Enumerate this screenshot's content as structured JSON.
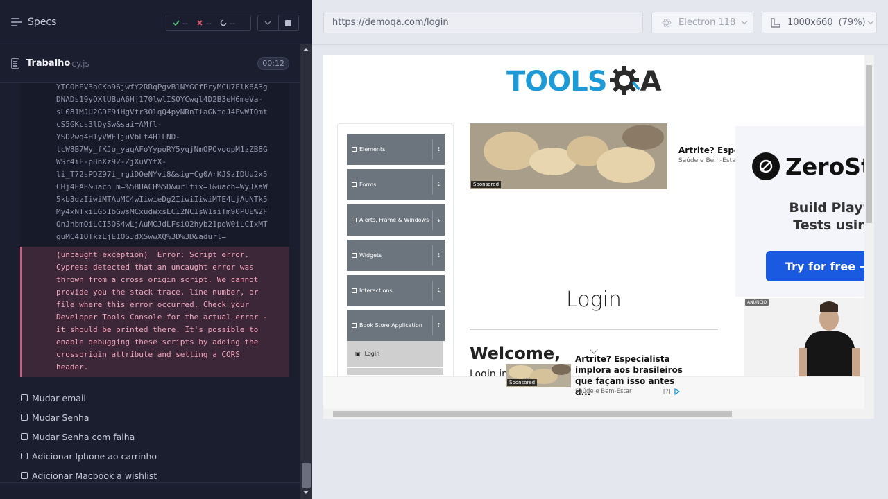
{
  "reporter": {
    "title": "Specs",
    "stats": {
      "passed": "--",
      "failed": "--",
      "pending": "--"
    },
    "spec_name": "Trabalho",
    "spec_ext": "cy.js",
    "timer": "00:12",
    "log_text": "YTGOhEV3aCKb96jwfY2RRqPgvB1NYGCfPryMCU7ElK6A3g\nDNADs19yOXlUBuA6Hj170lwlISOYCwgl4D2B3eH6meVa-\nsL081MJU2GDF9iHgVtr3OlqQ4pyNRnTiaGNtdJ4EwWIQmt\ncS5GKcs3lDySw&sai=AMfl-\nYSD2wq4HTyVWFTjuVbLt4H1LND-\ntcW8B7Wy_fKJo_yaqAFoYypoRY5yqjNmOPOvoopM1zZB8G\nWSr4iE-p8nXz92-ZjXuVYtX-\nli_T72sPDZ97i_rgiDQeNYvi8&sig=Cg0ArKJSzIDUu2x5\nCHj4EAE&uach_m=%5BUACH%5D&urlfix=1&uach=WyJXaW\n5kb3dzIiwiMTAuMC4wIiwieDg2IiwiIiwiMTE4LjAuNTk5\nMy4xNTkiLG51bGwsMCxudWxsLCI2NCIsW1siTm90PUE%2F\nQnJhbmQiLCI5OS4wLjAuMCJdLFsiQ2hyb21pdW0iLCIxMT\nguMC41OTkzLjE1OSJdXSwwXQ%3D%3D&adurl=",
    "error_text": "(uncaught exception)  Error: Script error.\nCypress detected that an uncaught error was\nthrown from a cross origin script. We cannot\nprovide you the stack trace, line number, or\nfile where this error occurred. Check your\nDeveloper Tools Console for the actual error -\nit should be printed there. It's possible to\nenable debugging these scripts by adding the\ncrossorigin attribute and setting a CORS\nheader.",
    "tests": [
      "Mudar email",
      "Mudar Senha",
      "Mudar Senha com falha",
      "Adicionar Iphone ao carrinho",
      "Adicionar Macbook a wishlist"
    ]
  },
  "toolbar": {
    "url": "https://demoqa.com/login",
    "browser": "Electron 118",
    "viewport": "1000x660",
    "zoom": "(79%)"
  },
  "aut": {
    "logo_text": "TOOLS",
    "logo_suffix": "QA",
    "menu_groups": [
      "Elements",
      "Forms",
      "Alerts, Frame & Windows",
      "Widgets",
      "Interactions",
      "Book Store Application"
    ],
    "menu_sub": "Login",
    "ad_top": {
      "tag": "Sponsored",
      "title": "Artrite? Espec",
      "source": "Saúde e Bem-Estar"
    },
    "zero_ad": {
      "brand": "ZeroSt",
      "headline_1": "Build Playwrig",
      "headline_2": "Tests using A",
      "cta": "Try for free →"
    },
    "athlete_ad": {
      "tag": "ANÚNCIO"
    },
    "login_heading": "Login",
    "welcome": "Welcome,",
    "login_in": "Login in Book Store",
    "sticky_ad": {
      "tag": "Sponsored",
      "text": "Artrite? Especialista implora aos brasileiros que façam isso antes d...",
      "source": "Saúde e Bem-Estar",
      "help": "[?]"
    }
  },
  "colors": {
    "toolsqa_blue": "#1e9bd7",
    "menu_grey": "#6c757d",
    "cta_blue": "#1a5ae0",
    "error_pink": "#f3a5bb"
  }
}
